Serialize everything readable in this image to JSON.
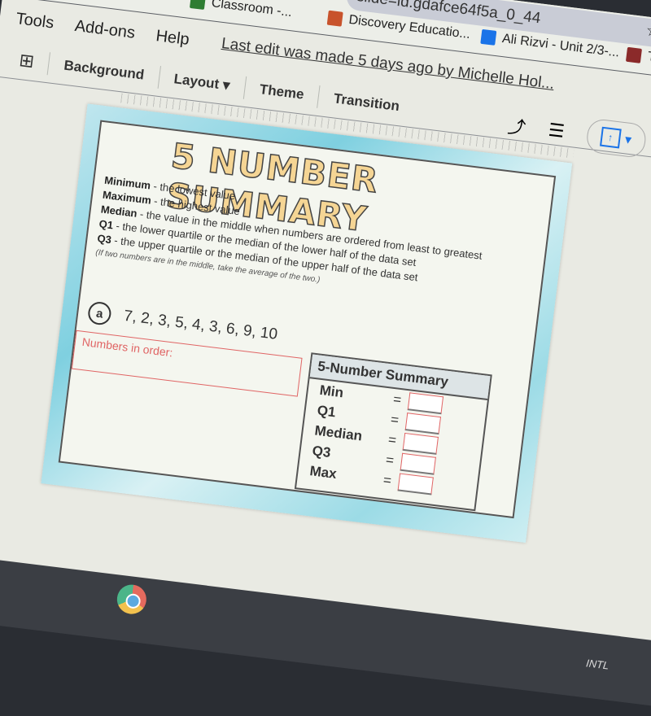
{
  "browser": {
    "url_fragment": "slide=id.gdafce64f5a_0_44",
    "bookmarks": [
      {
        "label": "Classroom -...",
        "icon": "classroom-icon",
        "color": "#2e7d32"
      },
      {
        "label": "Discovery Educatio...",
        "icon": "discovery-icon",
        "color": "#c8532c"
      },
      {
        "label": "Ali Rizvi - Unit 2/3-...",
        "icon": "docs-icon",
        "color": "#1a73e8"
      },
      {
        "label": "Test Ta...",
        "icon": "test-icon",
        "color": "#8b2a2a"
      }
    ],
    "star_icon": "☆"
  },
  "menu": {
    "items": [
      "Tools",
      "Add-ons",
      "Help"
    ],
    "last_edit": "Last edit was made 5 days ago by Michelle Hol..."
  },
  "toolbar": {
    "new_comment_icon": "⊞",
    "background": "Background",
    "layout": "Layout",
    "theme": "Theme",
    "transition": "Transition",
    "trend_icon": "⤴",
    "comments_icon": "☰",
    "present_icon": "↑",
    "play_icon": "▶"
  },
  "slide": {
    "title": "5 NUMBER SUMMARY",
    "definitions": [
      {
        "term": "Minimum",
        "text": " - the lowest value"
      },
      {
        "term": "Maximum",
        "text": " - the highest value"
      },
      {
        "term": "Median",
        "text": " - the value in the middle when numbers are ordered from least to greatest"
      },
      {
        "term": "Q1",
        "text": " - the lower quartile or the median of the lower half of the data set"
      },
      {
        "term": "Q3",
        "text": " - the upper quartile or the median of the upper half of the data set"
      }
    ],
    "note": "(If two numbers are in the middle, take the average of the two.)",
    "problem_label": "a",
    "problem_numbers": "7, 2, 3, 5, 4, 3, 6, 9, 10",
    "order_placeholder": "Numbers in order:",
    "summary": {
      "title": "5-Number Summary",
      "rows": [
        {
          "label": "Min",
          "eq": "=",
          "value": ""
        },
        {
          "label": "Q1",
          "eq": "=",
          "value": ""
        },
        {
          "label": "Median",
          "eq": "=",
          "value": ""
        },
        {
          "label": "Q3",
          "eq": "=",
          "value": ""
        },
        {
          "label": "Max",
          "eq": "=",
          "value": ""
        }
      ]
    }
  },
  "taskbar": {
    "ime_label": "INTL"
  }
}
